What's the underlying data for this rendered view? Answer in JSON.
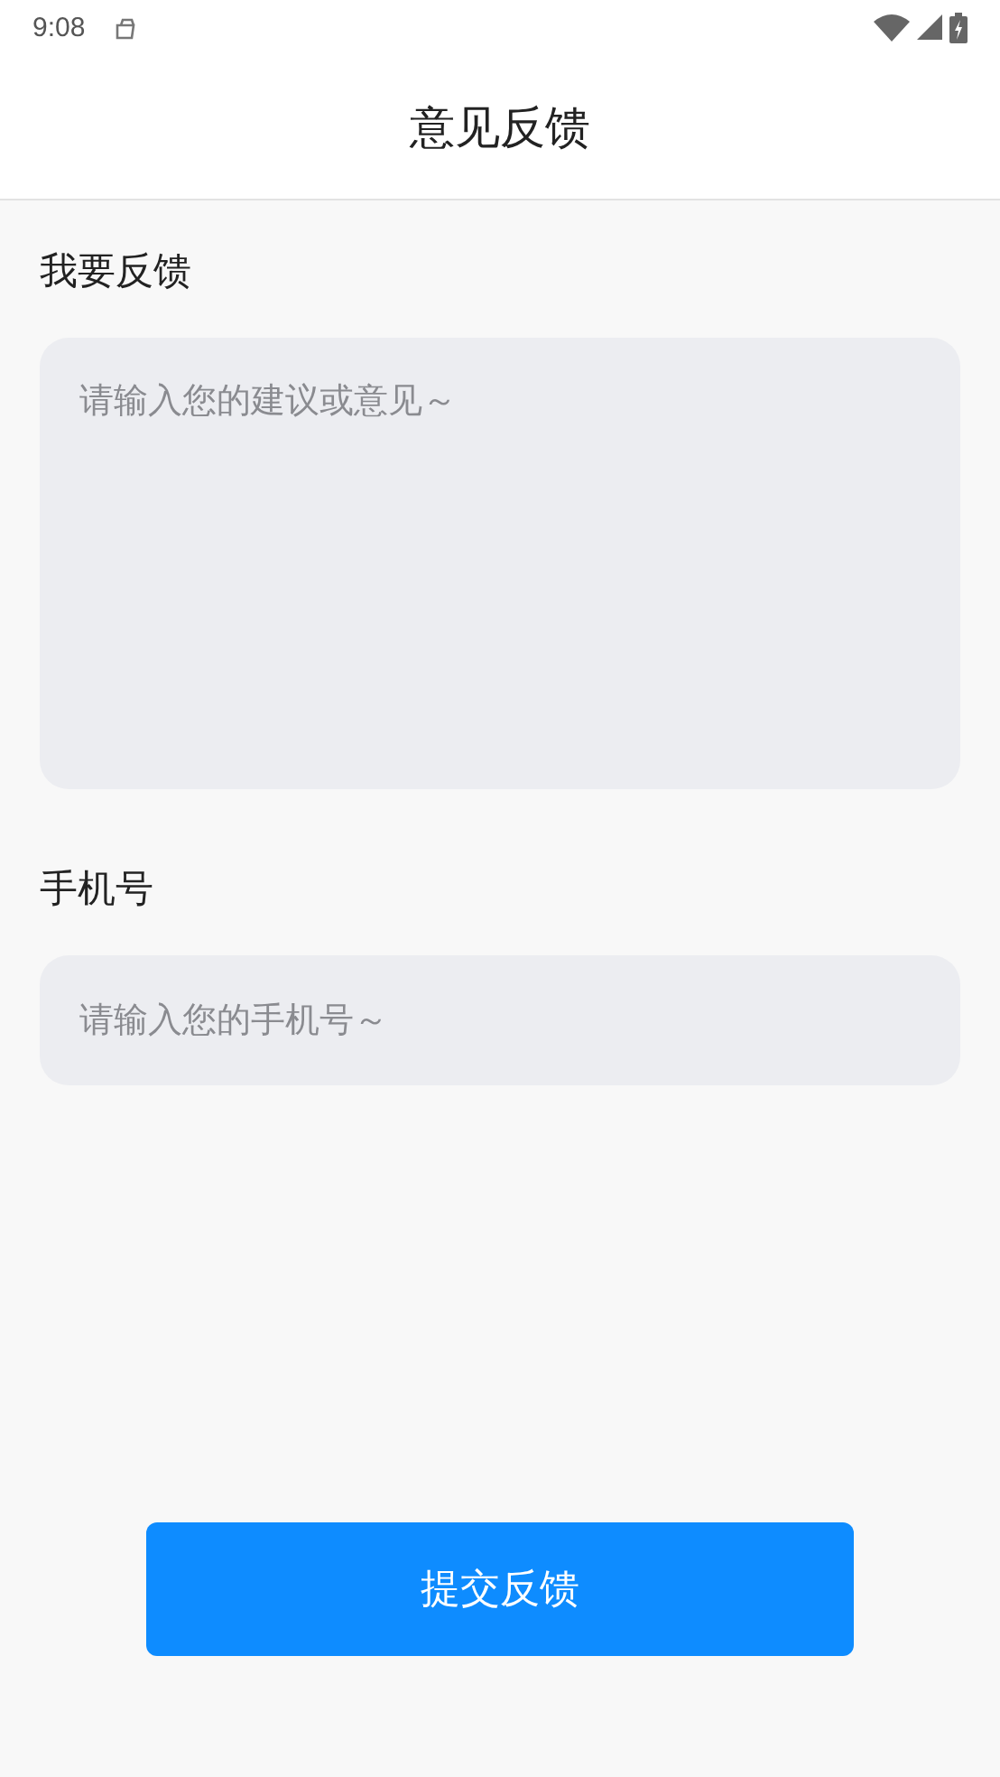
{
  "status_bar": {
    "time": "9:08"
  },
  "header": {
    "title": "意见反馈"
  },
  "form": {
    "feedback": {
      "label": "我要反馈",
      "placeholder": "请输入您的建议或意见～"
    },
    "phone": {
      "label": "手机号",
      "placeholder": "请输入您的手机号～"
    }
  },
  "submit_button": "提交反馈"
}
